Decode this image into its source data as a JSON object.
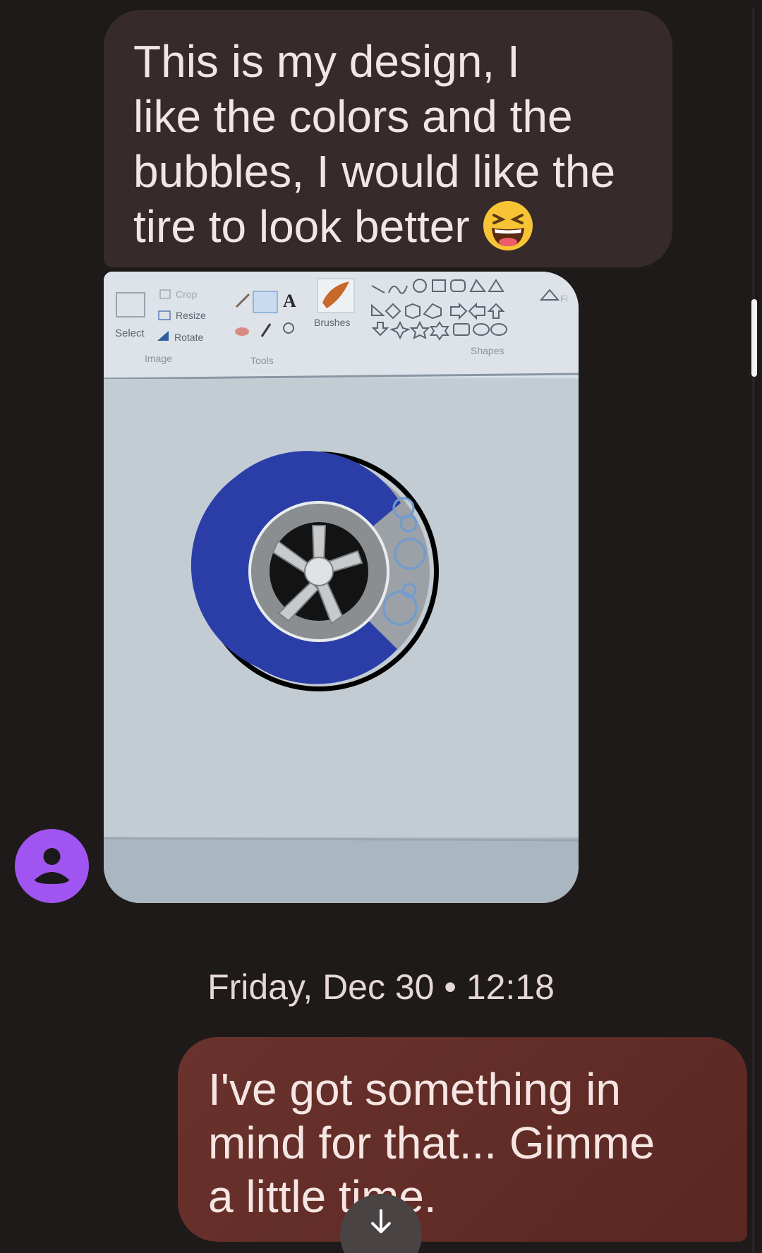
{
  "conversation": {
    "incoming_text": {
      "lines": [
        "This is my design, I",
        "like the colors and the",
        "bubbles, I would like the",
        "tire to look better"
      ],
      "emoji": "laughing-emoji"
    },
    "incoming_image": {
      "paint_toolbar": {
        "select_label": "Select",
        "crop_label": "Crop",
        "resize_label": "Resize",
        "rotate_label": "Rotate",
        "image_group_label": "Image",
        "tools_group_label": "Tools",
        "brushes_label": "Brushes",
        "shapes_group_label": "Shapes",
        "text_tool_label": "A",
        "fill_label": "Fi"
      }
    },
    "timestamp": "Friday, Dec 30 • 12:18",
    "outgoing_text": {
      "lines": [
        "I've got something in",
        "mind for that... Gimme",
        "a little time."
      ]
    }
  },
  "icons": {
    "avatar": "person-icon",
    "scroll_down": "arrow-down-icon"
  },
  "colors": {
    "background": "#1f1a1a",
    "incoming_bubble": "#362b2a",
    "outgoing_bubble": "#652e29",
    "avatar": "#a155f0",
    "tire_blue": "#2b3ea8"
  }
}
